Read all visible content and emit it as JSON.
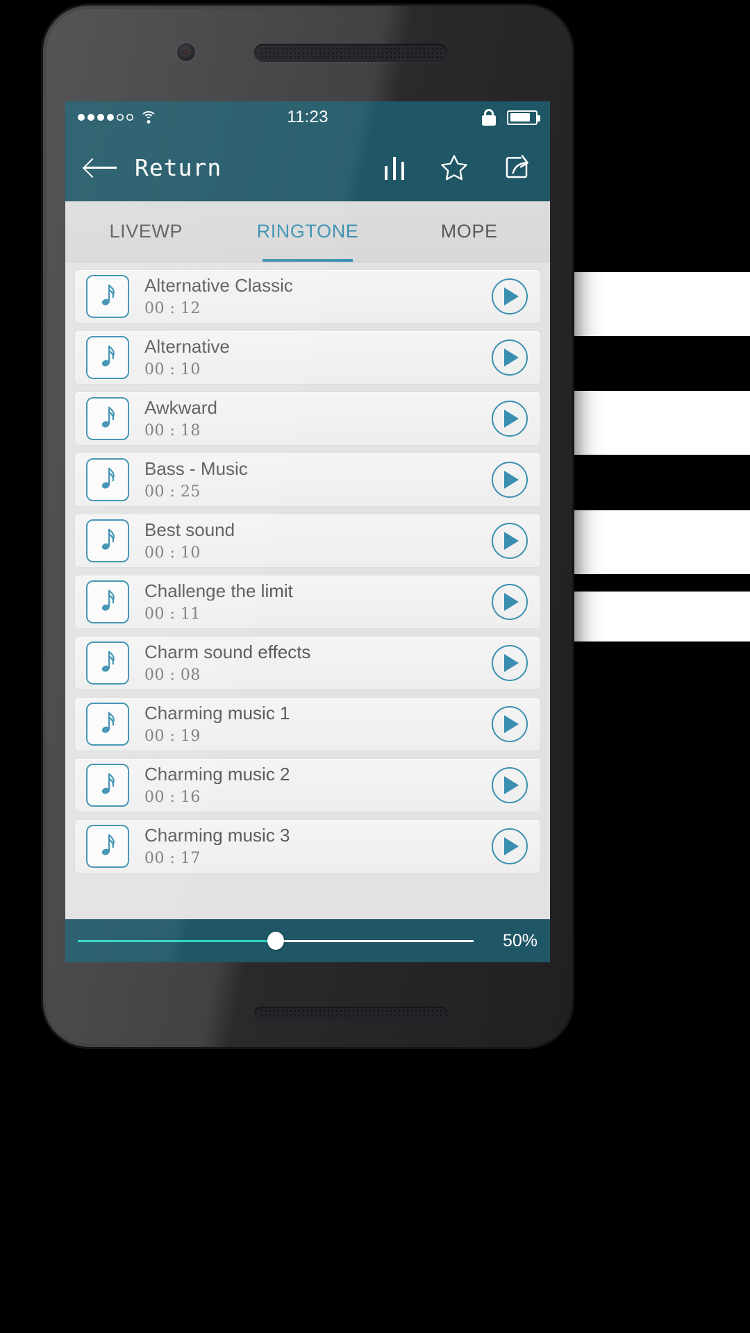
{
  "statusbar": {
    "signal_dots_total": 6,
    "signal_dots_filled": 4,
    "wifi_icon": "wifi-icon",
    "time": "11:23",
    "lock_icon": "lock-icon",
    "battery_icon": "battery-icon",
    "battery_level_pct": 70
  },
  "appbar": {
    "back_icon": "back-arrow-icon",
    "title": "Return",
    "actions": [
      {
        "name": "equalizer-icon",
        "label": "Equalizer"
      },
      {
        "name": "star-icon",
        "label": "Favorite"
      },
      {
        "name": "share-icon",
        "label": "Share"
      }
    ]
  },
  "tabs": [
    {
      "label": "LIVEWP",
      "active": false
    },
    {
      "label": "RINGTONE",
      "active": true
    },
    {
      "label": "MOPE",
      "active": false
    }
  ],
  "list": {
    "item_icon": "music-note-icon",
    "play_icon": "play-icon",
    "items": [
      {
        "title": "Alternative Classic",
        "minutes": "00",
        "separator": ":",
        "seconds": "12"
      },
      {
        "title": "Alternative",
        "minutes": "00",
        "separator": ":",
        "seconds": "10"
      },
      {
        "title": "Awkward",
        "minutes": "00",
        "separator": ":",
        "seconds": "18"
      },
      {
        "title": "Bass - Music",
        "minutes": "00",
        "separator": ":",
        "seconds": "25"
      },
      {
        "title": "Best sound",
        "minutes": "00",
        "separator": ":",
        "seconds": "10"
      },
      {
        "title": "Challenge the limit",
        "minutes": "00",
        "separator": ":",
        "seconds": "11"
      },
      {
        "title": "Charm sound effects",
        "minutes": "00",
        "separator": ":",
        "seconds": "08"
      },
      {
        "title": "Charming music 1",
        "minutes": "00",
        "separator": ":",
        "seconds": "19"
      },
      {
        "title": "Charming music 2",
        "minutes": "00",
        "separator": ":",
        "seconds": "16"
      },
      {
        "title": "Charming music 3",
        "minutes": "00",
        "separator": ":",
        "seconds": "17"
      }
    ]
  },
  "volume_slider": {
    "value_label": "50%",
    "value": 50,
    "min": 0,
    "max": 100
  },
  "colors": {
    "brand_teal": "#1f5766",
    "accent_blue": "#3a8fb0",
    "slider_fill": "#2fd6c0",
    "screen_bg": "#e2e2e2",
    "row_bg": "#f1f1f1",
    "tab_inactive": "#5b5b5b"
  }
}
